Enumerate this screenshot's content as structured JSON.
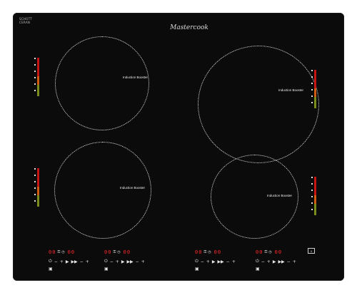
{
  "cooktop": {
    "logo_text": "Mastercook",
    "glass_mark_lines": [
      "SCHOTT",
      "CERAN"
    ],
    "zones": [
      {
        "id": "top-left",
        "label": "Induction Booster"
      },
      {
        "id": "top-right",
        "label": "Induction Booster"
      },
      {
        "id": "bottom-left",
        "label": "Induction Booster"
      },
      {
        "id": "bottom-right",
        "label": "Induction Booster"
      }
    ],
    "controls": [
      {
        "digits_left": "00",
        "digits_right": "00",
        "minus": "−",
        "plus": "+",
        "boost": "▶",
        "boost2": "▶▶",
        "timer": "◷",
        "lock": "⚿"
      },
      {
        "digits_left": "00",
        "digits_right": "00",
        "minus": "−",
        "plus": "+",
        "boost": "▶",
        "boost2": "▶▶",
        "timer": "◷",
        "lock": "⚿"
      },
      {
        "digits_left": "00",
        "digits_right": "00",
        "minus": "−",
        "plus": "+",
        "boost": "▶",
        "boost2": "▶▶",
        "timer": "◷",
        "lock": "⚿"
      },
      {
        "digits_left": "00",
        "digits_right": "00",
        "minus": "−",
        "plus": "+",
        "boost": "▶",
        "boost2": "▶▶",
        "timer": "◷",
        "lock": "⚿"
      }
    ],
    "pause_symbol": "II",
    "colors": {
      "glass": "#0b0b0c",
      "display_red": "#ff2a2a",
      "meter_red": "#c41414",
      "meter_orange": "#d05a10",
      "meter_green": "#7a8c1a"
    }
  }
}
